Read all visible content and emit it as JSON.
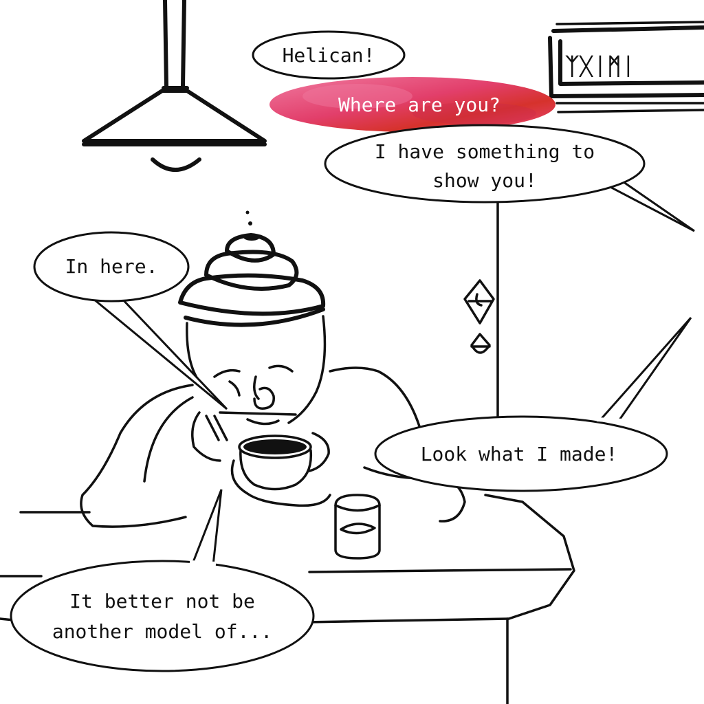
{
  "bubbles": {
    "helican": "Helican!",
    "where": "Where are you?",
    "something_line1": "I have something to",
    "something_line2": "show you!",
    "in_here": "In here.",
    "look": "Look what I made!",
    "better_line1": "It better not be",
    "better_line2": "another model of..."
  },
  "sign": {
    "glyphs": "ᛉᚷᛁᛗᛁ"
  },
  "colors": {
    "ink": "#111111",
    "splash_a": "#e8457a",
    "splash_b": "#d6322c",
    "splash_c": "#f07aa0"
  }
}
